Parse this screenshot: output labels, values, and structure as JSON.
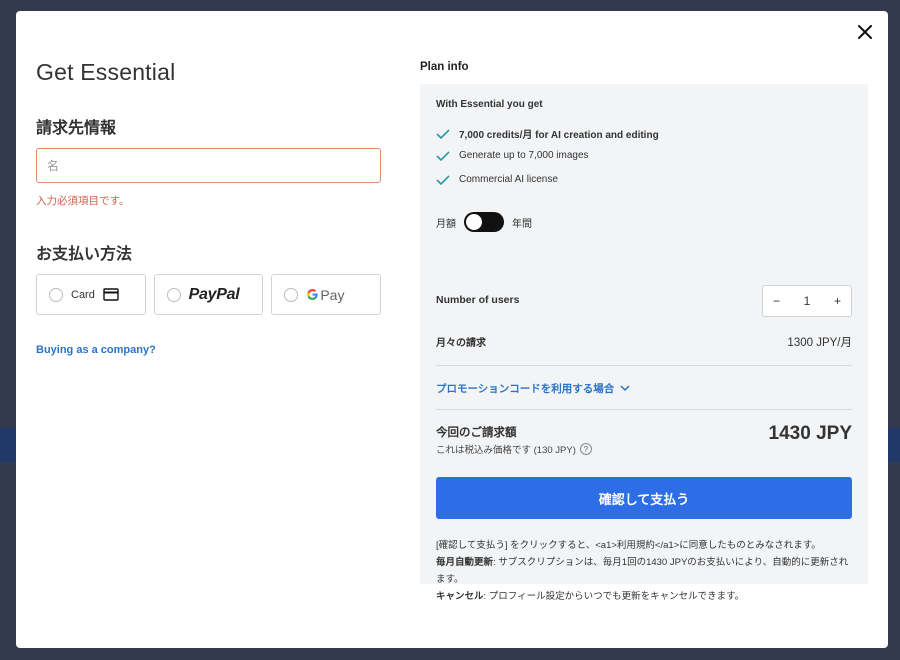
{
  "modal": {
    "title": "Get Essential",
    "close_icon": "close-icon"
  },
  "billing": {
    "heading": "請求先情報",
    "name_placeholder": "名",
    "name_value": "",
    "error": "入力必須項目です。"
  },
  "payment": {
    "heading": "お支払い方法",
    "options": [
      {
        "label": "Card",
        "icon": "card-icon"
      },
      {
        "label": "PayPal",
        "icon": "paypal-logo"
      },
      {
        "label": "Pay",
        "icon": "google-g-logo"
      }
    ],
    "company_link": "Buying as a company?"
  },
  "plan": {
    "heading": "Plan info",
    "with_label": "With Essential you get",
    "features": [
      "7,000 credits/月 for AI creation and editing",
      "Generate up to 7,000 images",
      "Commercial AI license"
    ],
    "toggle_left": "月額",
    "toggle_right": "年間",
    "toggle_state": "monthly",
    "users_label": "Number of users",
    "users_minus": "−",
    "users_count": "1",
    "users_plus": "+",
    "monthly_label": "月々の請求",
    "monthly_value": "1300 JPY/月",
    "promo": "プロモーションコードを利用する場合",
    "due_label": "今回のご請求額",
    "tax_note": "これは税込み価格です (130 JPY)",
    "total": "1430 JPY",
    "confirm_button": "確認して支払う",
    "legal_line1": "[確認して支払う] をクリックすると、<a1>利用規約</a1>に同意したものとみなされます。",
    "legal_auto_label": "毎月自動更新",
    "legal_auto_text": ": サブスクリプションは、毎月1回の1430 JPYのお支払いにより、自動的に更新されます。",
    "legal_cancel_label": "キャンセル",
    "legal_cancel_text": ": プロフィール設定からいつでも更新をキャンセルできます。"
  },
  "colors": {
    "accent": "#2d6ee6",
    "link": "#2b74c5",
    "error": "#d0604a",
    "check": "#2b9aa8"
  }
}
